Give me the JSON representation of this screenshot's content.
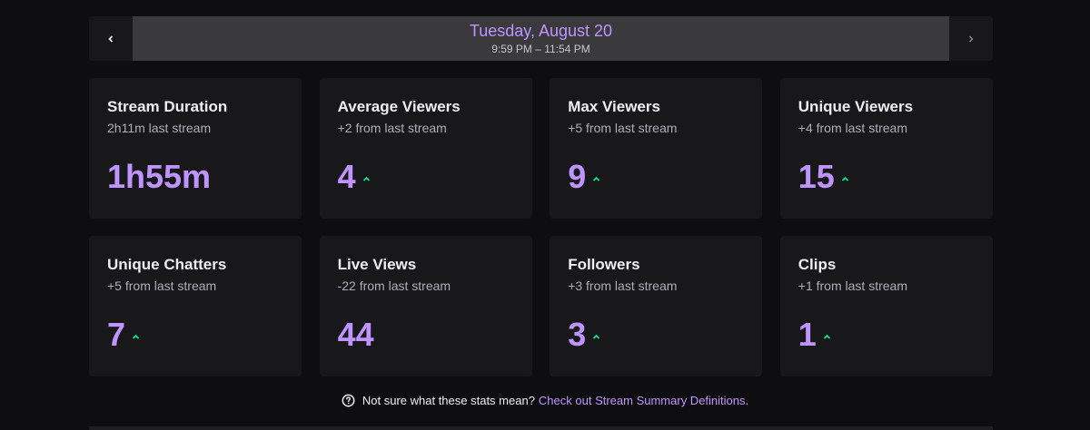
{
  "date_nav": {
    "title": "Tuesday, August 20",
    "time_range": "9:59 PM – 11:54 PM"
  },
  "cards": [
    {
      "title": "Stream Duration",
      "subtitle": "2h11m last stream",
      "value": "1h55m",
      "trend": "none"
    },
    {
      "title": "Average Viewers",
      "subtitle": "+2 from last stream",
      "value": "4",
      "trend": "up"
    },
    {
      "title": "Max Viewers",
      "subtitle": "+5 from last stream",
      "value": "9",
      "trend": "up"
    },
    {
      "title": "Unique Viewers",
      "subtitle": "+4 from last stream",
      "value": "15",
      "trend": "up"
    },
    {
      "title": "Unique Chatters",
      "subtitle": "+5 from last stream",
      "value": "7",
      "trend": "up"
    },
    {
      "title": "Live Views",
      "subtitle": "-22 from last stream",
      "value": "44",
      "trend": "none"
    },
    {
      "title": "Followers",
      "subtitle": "+3 from last stream",
      "value": "3",
      "trend": "up"
    },
    {
      "title": "Clips",
      "subtitle": "+1 from last stream",
      "value": "1",
      "trend": "up"
    }
  ],
  "help": {
    "text": "Not sure what these stats mean?",
    "link": "Check out Stream Summary Definitions."
  },
  "colors": {
    "accent": "#bf94ff",
    "trend_up": "#00f593",
    "background": "#0e0e10",
    "card": "#18181b"
  },
  "icons": {
    "prev": "chevron-left-icon",
    "next": "chevron-right-icon",
    "trend": "trend-up-icon",
    "help": "question-circle-icon"
  }
}
